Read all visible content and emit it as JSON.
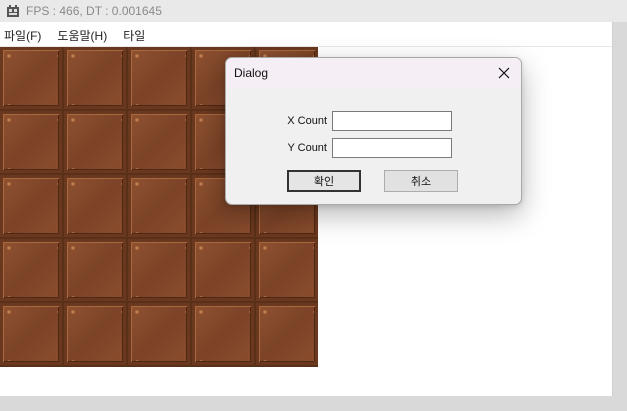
{
  "window": {
    "title": "FPS : 466, DT : 0.001645",
    "icon": "app-icon"
  },
  "menu": {
    "items": [
      {
        "label": "파일(F)"
      },
      {
        "label": "도움말(H)"
      },
      {
        "label": "타일"
      }
    ]
  },
  "tile_grid": {
    "rows": 5,
    "cols": 5,
    "tile_color": "#8e5231",
    "grout_color": "#5a3018"
  },
  "dialog": {
    "title": "Dialog",
    "close_icon": "close-icon",
    "fields": [
      {
        "label": "X Count",
        "value": ""
      },
      {
        "label": "Y Count",
        "value": ""
      }
    ],
    "ok_label": "확인",
    "cancel_label": "취소"
  }
}
